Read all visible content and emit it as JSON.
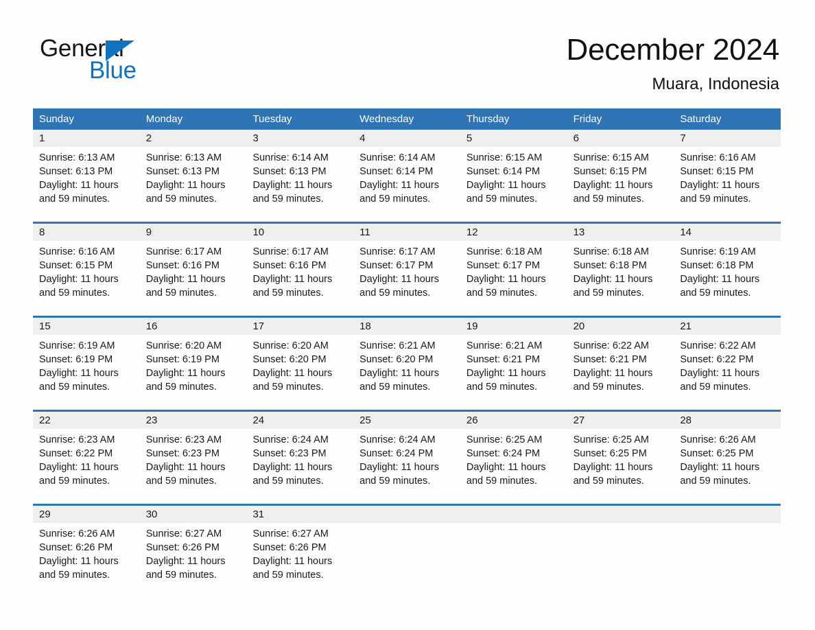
{
  "brand": {
    "name_part1": "General",
    "name_part2": "Blue",
    "logo_color": "#1272bd",
    "triangle_icon": "triangle-icon"
  },
  "header": {
    "month_title": "December 2024",
    "location": "Muara, Indonesia"
  },
  "theme": {
    "header_blue": "#2f75b5",
    "date_band_gray": "#efefef",
    "text_color": "#1a1a1a"
  },
  "calendar": {
    "weekday_headers": [
      "Sunday",
      "Monday",
      "Tuesday",
      "Wednesday",
      "Thursday",
      "Friday",
      "Saturday"
    ],
    "weeks": [
      {
        "days": [
          {
            "date": "1",
            "sunrise": "Sunrise: 6:13 AM",
            "sunset": "Sunset: 6:13 PM",
            "daylight_line1": "Daylight: 11 hours",
            "daylight_line2": "and 59 minutes."
          },
          {
            "date": "2",
            "sunrise": "Sunrise: 6:13 AM",
            "sunset": "Sunset: 6:13 PM",
            "daylight_line1": "Daylight: 11 hours",
            "daylight_line2": "and 59 minutes."
          },
          {
            "date": "3",
            "sunrise": "Sunrise: 6:14 AM",
            "sunset": "Sunset: 6:13 PM",
            "daylight_line1": "Daylight: 11 hours",
            "daylight_line2": "and 59 minutes."
          },
          {
            "date": "4",
            "sunrise": "Sunrise: 6:14 AM",
            "sunset": "Sunset: 6:14 PM",
            "daylight_line1": "Daylight: 11 hours",
            "daylight_line2": "and 59 minutes."
          },
          {
            "date": "5",
            "sunrise": "Sunrise: 6:15 AM",
            "sunset": "Sunset: 6:14 PM",
            "daylight_line1": "Daylight: 11 hours",
            "daylight_line2": "and 59 minutes."
          },
          {
            "date": "6",
            "sunrise": "Sunrise: 6:15 AM",
            "sunset": "Sunset: 6:15 PM",
            "daylight_line1": "Daylight: 11 hours",
            "daylight_line2": "and 59 minutes."
          },
          {
            "date": "7",
            "sunrise": "Sunrise: 6:16 AM",
            "sunset": "Sunset: 6:15 PM",
            "daylight_line1": "Daylight: 11 hours",
            "daylight_line2": "and 59 minutes."
          }
        ]
      },
      {
        "days": [
          {
            "date": "8",
            "sunrise": "Sunrise: 6:16 AM",
            "sunset": "Sunset: 6:15 PM",
            "daylight_line1": "Daylight: 11 hours",
            "daylight_line2": "and 59 minutes."
          },
          {
            "date": "9",
            "sunrise": "Sunrise: 6:17 AM",
            "sunset": "Sunset: 6:16 PM",
            "daylight_line1": "Daylight: 11 hours",
            "daylight_line2": "and 59 minutes."
          },
          {
            "date": "10",
            "sunrise": "Sunrise: 6:17 AM",
            "sunset": "Sunset: 6:16 PM",
            "daylight_line1": "Daylight: 11 hours",
            "daylight_line2": "and 59 minutes."
          },
          {
            "date": "11",
            "sunrise": "Sunrise: 6:17 AM",
            "sunset": "Sunset: 6:17 PM",
            "daylight_line1": "Daylight: 11 hours",
            "daylight_line2": "and 59 minutes."
          },
          {
            "date": "12",
            "sunrise": "Sunrise: 6:18 AM",
            "sunset": "Sunset: 6:17 PM",
            "daylight_line1": "Daylight: 11 hours",
            "daylight_line2": "and 59 minutes."
          },
          {
            "date": "13",
            "sunrise": "Sunrise: 6:18 AM",
            "sunset": "Sunset: 6:18 PM",
            "daylight_line1": "Daylight: 11 hours",
            "daylight_line2": "and 59 minutes."
          },
          {
            "date": "14",
            "sunrise": "Sunrise: 6:19 AM",
            "sunset": "Sunset: 6:18 PM",
            "daylight_line1": "Daylight: 11 hours",
            "daylight_line2": "and 59 minutes."
          }
        ]
      },
      {
        "days": [
          {
            "date": "15",
            "sunrise": "Sunrise: 6:19 AM",
            "sunset": "Sunset: 6:19 PM",
            "daylight_line1": "Daylight: 11 hours",
            "daylight_line2": "and 59 minutes."
          },
          {
            "date": "16",
            "sunrise": "Sunrise: 6:20 AM",
            "sunset": "Sunset: 6:19 PM",
            "daylight_line1": "Daylight: 11 hours",
            "daylight_line2": "and 59 minutes."
          },
          {
            "date": "17",
            "sunrise": "Sunrise: 6:20 AM",
            "sunset": "Sunset: 6:20 PM",
            "daylight_line1": "Daylight: 11 hours",
            "daylight_line2": "and 59 minutes."
          },
          {
            "date": "18",
            "sunrise": "Sunrise: 6:21 AM",
            "sunset": "Sunset: 6:20 PM",
            "daylight_line1": "Daylight: 11 hours",
            "daylight_line2": "and 59 minutes."
          },
          {
            "date": "19",
            "sunrise": "Sunrise: 6:21 AM",
            "sunset": "Sunset: 6:21 PM",
            "daylight_line1": "Daylight: 11 hours",
            "daylight_line2": "and 59 minutes."
          },
          {
            "date": "20",
            "sunrise": "Sunrise: 6:22 AM",
            "sunset": "Sunset: 6:21 PM",
            "daylight_line1": "Daylight: 11 hours",
            "daylight_line2": "and 59 minutes."
          },
          {
            "date": "21",
            "sunrise": "Sunrise: 6:22 AM",
            "sunset": "Sunset: 6:22 PM",
            "daylight_line1": "Daylight: 11 hours",
            "daylight_line2": "and 59 minutes."
          }
        ]
      },
      {
        "days": [
          {
            "date": "22",
            "sunrise": "Sunrise: 6:23 AM",
            "sunset": "Sunset: 6:22 PM",
            "daylight_line1": "Daylight: 11 hours",
            "daylight_line2": "and 59 minutes."
          },
          {
            "date": "23",
            "sunrise": "Sunrise: 6:23 AM",
            "sunset": "Sunset: 6:23 PM",
            "daylight_line1": "Daylight: 11 hours",
            "daylight_line2": "and 59 minutes."
          },
          {
            "date": "24",
            "sunrise": "Sunrise: 6:24 AM",
            "sunset": "Sunset: 6:23 PM",
            "daylight_line1": "Daylight: 11 hours",
            "daylight_line2": "and 59 minutes."
          },
          {
            "date": "25",
            "sunrise": "Sunrise: 6:24 AM",
            "sunset": "Sunset: 6:24 PM",
            "daylight_line1": "Daylight: 11 hours",
            "daylight_line2": "and 59 minutes."
          },
          {
            "date": "26",
            "sunrise": "Sunrise: 6:25 AM",
            "sunset": "Sunset: 6:24 PM",
            "daylight_line1": "Daylight: 11 hours",
            "daylight_line2": "and 59 minutes."
          },
          {
            "date": "27",
            "sunrise": "Sunrise: 6:25 AM",
            "sunset": "Sunset: 6:25 PM",
            "daylight_line1": "Daylight: 11 hours",
            "daylight_line2": "and 59 minutes."
          },
          {
            "date": "28",
            "sunrise": "Sunrise: 6:26 AM",
            "sunset": "Sunset: 6:25 PM",
            "daylight_line1": "Daylight: 11 hours",
            "daylight_line2": "and 59 minutes."
          }
        ]
      },
      {
        "days": [
          {
            "date": "29",
            "sunrise": "Sunrise: 6:26 AM",
            "sunset": "Sunset: 6:26 PM",
            "daylight_line1": "Daylight: 11 hours",
            "daylight_line2": "and 59 minutes."
          },
          {
            "date": "30",
            "sunrise": "Sunrise: 6:27 AM",
            "sunset": "Sunset: 6:26 PM",
            "daylight_line1": "Daylight: 11 hours",
            "daylight_line2": "and 59 minutes."
          },
          {
            "date": "31",
            "sunrise": "Sunrise: 6:27 AM",
            "sunset": "Sunset: 6:26 PM",
            "daylight_line1": "Daylight: 11 hours",
            "daylight_line2": "and 59 minutes."
          },
          {
            "date": "",
            "sunrise": "",
            "sunset": "",
            "daylight_line1": "",
            "daylight_line2": ""
          },
          {
            "date": "",
            "sunrise": "",
            "sunset": "",
            "daylight_line1": "",
            "daylight_line2": ""
          },
          {
            "date": "",
            "sunrise": "",
            "sunset": "",
            "daylight_line1": "",
            "daylight_line2": ""
          },
          {
            "date": "",
            "sunrise": "",
            "sunset": "",
            "daylight_line1": "",
            "daylight_line2": ""
          }
        ]
      }
    ]
  }
}
